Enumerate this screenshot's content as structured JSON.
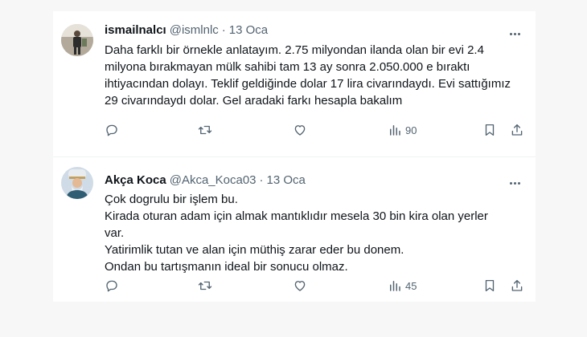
{
  "tweets": [
    {
      "name": "ismailnalcı",
      "handle": "@ismlnlc",
      "separator": "·",
      "date": "13 Oca",
      "text_lines": [
        "Daha farklı bir örnekle anlatayım. 2.75 milyondan ilanda olan bir evi 2.4",
        "milyona bırakmayan mülk sahibi tam 13 ay sonra 2.050.000 e bıraktı",
        "ihtiyacından dolayı. Teklif geldiğinde dolar 17 lira civarındaydı. Evi sattığımız",
        "29 civarındaydı dolar. Gel aradaki farkı hesapla bakalım"
      ],
      "views": "90",
      "avatar": "person-photo",
      "icons": [
        "reply-icon",
        "retweet-icon",
        "like-icon",
        "views-icon",
        "bookmark-icon",
        "share-icon",
        "more-icon"
      ]
    },
    {
      "name": "Akça Koca",
      "handle": "@Akca_Koca03",
      "separator": "·",
      "date": "13 Oca",
      "text_lines": [
        "Çok dogrulu bir işlem bu.",
        "Kirada oturan adam için almak mantıklıdır mesela 30 bin kira olan yerler",
        "var.",
        "Yatirimlik tutan ve alan için müthiş zarar eder bu donem.",
        "Ondan bu tartışmanın ideal bir sonucu olmaz."
      ],
      "views": "45",
      "avatar": "elder-with-hat-illustration",
      "icons": [
        "reply-icon",
        "retweet-icon",
        "like-icon",
        "views-icon",
        "bookmark-icon",
        "share-icon",
        "more-icon"
      ]
    }
  ],
  "colors": {
    "text": "#0f1419",
    "secondary": "#536471",
    "divider": "#eff3f4",
    "page_bg": "#f7f7f7"
  }
}
